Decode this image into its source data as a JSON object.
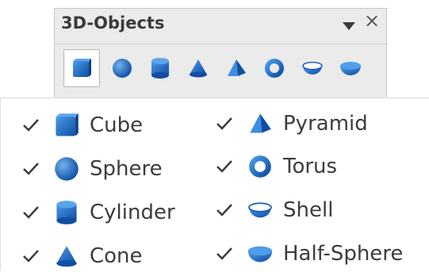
{
  "toolbar": {
    "title": "3D-Objects",
    "menu_icon": "triangle-down-icon",
    "close_icon": "close-icon",
    "buttons": [
      {
        "name": "cube",
        "active": true
      },
      {
        "name": "sphere",
        "active": false
      },
      {
        "name": "cylinder",
        "active": false
      },
      {
        "name": "cone",
        "active": false
      },
      {
        "name": "pyramid",
        "active": false
      },
      {
        "name": "torus",
        "active": false
      },
      {
        "name": "shell",
        "active": false
      },
      {
        "name": "half-sphere",
        "active": false
      }
    ]
  },
  "menu": {
    "items": [
      {
        "label": "Cube",
        "checked": true,
        "icon": "cube-icon"
      },
      {
        "label": "Sphere",
        "checked": true,
        "icon": "sphere-icon"
      },
      {
        "label": "Cylinder",
        "checked": true,
        "icon": "cylinder-icon"
      },
      {
        "label": "Cone",
        "checked": true,
        "icon": "cone-icon"
      },
      {
        "label": "Pyramid",
        "checked": true,
        "icon": "pyramid-icon"
      },
      {
        "label": "Torus",
        "checked": true,
        "icon": "torus-icon"
      },
      {
        "label": "Shell",
        "checked": true,
        "icon": "shell-icon"
      },
      {
        "label": "Half-Sphere",
        "checked": true,
        "icon": "half-sphere-icon"
      }
    ]
  },
  "colors": {
    "icon_blue": "#1a5fb4",
    "icon_light": "#3d8ee0",
    "text": "#3c3c3c"
  }
}
